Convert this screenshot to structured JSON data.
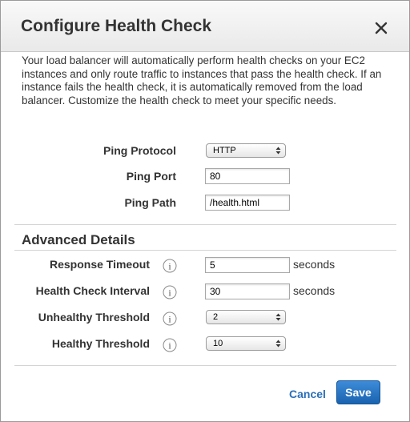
{
  "dialog": {
    "title": "Configure Health Check",
    "close_icon": "close-icon",
    "description": "Your load balancer will automatically perform health checks on your EC2 instances and only route traffic to instances that pass the health check. If an instance fails the health check, it is automatically removed from the load balancer. Customize the health check to meet your specific needs."
  },
  "ping": {
    "protocol_label": "Ping Protocol",
    "protocol_value": "HTTP",
    "port_label": "Ping Port",
    "port_value": "80",
    "path_label": "Ping Path",
    "path_value": "/health.html"
  },
  "advanced": {
    "title": "Advanced Details",
    "info_icon": "info-icon",
    "response_timeout_label": "Response Timeout",
    "response_timeout_value": "5",
    "response_timeout_unit": "seconds",
    "interval_label": "Health Check Interval",
    "interval_value": "30",
    "interval_unit": "seconds",
    "unhealthy_label": "Unhealthy Threshold",
    "unhealthy_value": "2",
    "healthy_label": "Healthy Threshold",
    "healthy_value": "10"
  },
  "footer": {
    "cancel_label": "Cancel",
    "save_label": "Save"
  },
  "colors": {
    "link": "#2a6fb8",
    "primary_button": "#1f6fc3"
  }
}
